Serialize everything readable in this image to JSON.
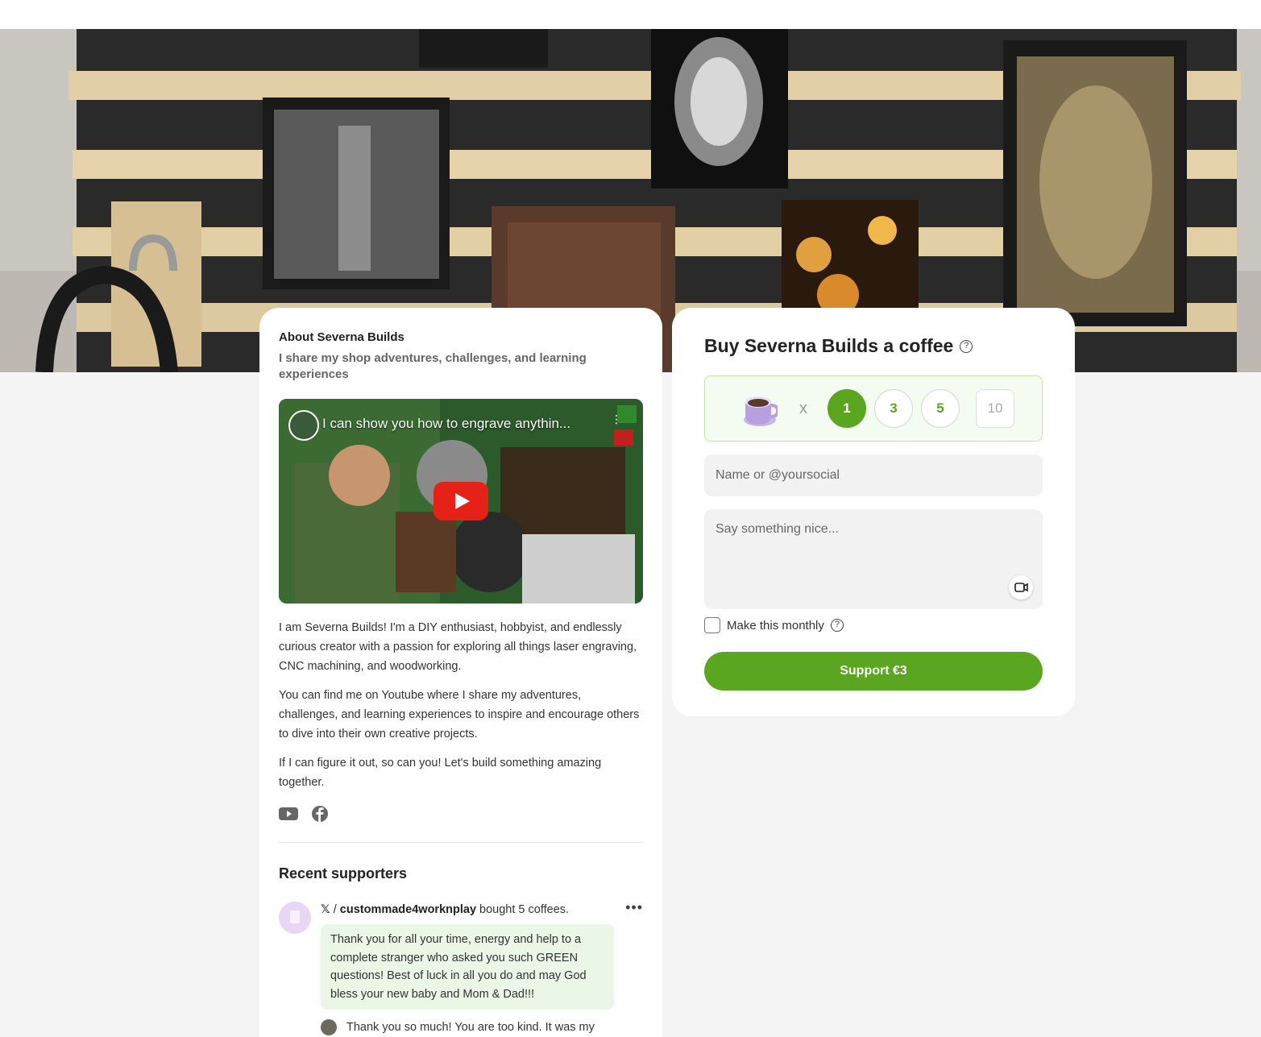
{
  "about": {
    "title": "About Severna Builds",
    "tagline": "I share my shop adventures, challenges, and learning experiences",
    "video": {
      "title": "I can show you how to engrave anythin..."
    },
    "bio": [
      "I am Severna Builds! I'm a DIY enthusiast, hobbyist, and endlessly curious creator with a passion for exploring all things laser engraving, CNC machining, and woodworking.",
      "You can find me on Youtube where I share my adventures, challenges, and learning experiences to inspire and encourage others to dive into their own creative projects.",
      "If I can figure it out, so can you! Let's build something amazing together."
    ],
    "social": [
      "youtube-icon",
      "facebook-icon"
    ]
  },
  "recent": {
    "title": "Recent supporters",
    "items": [
      {
        "platform": "𝕏",
        "handle": "custommade4worknplay",
        "action": "bought 5 coffees.",
        "message": "Thank you for all your time, energy and help to a complete stranger who asked you such GREEN questions! Best of luck in all you do and may God bless your new baby and Mom & Dad!!!",
        "reply": "Thank you so much! You are too kind. It was my"
      }
    ]
  },
  "buy": {
    "title": "Buy Severna Builds a coffee",
    "help": "?",
    "times": "x",
    "options": [
      "1",
      "3",
      "5"
    ],
    "selected": "1",
    "custom_value": "10",
    "name_placeholder": "Name or @yoursocial",
    "message_placeholder": "Say something nice...",
    "monthly_label": "Make this monthly",
    "support_label": "Support €3"
  },
  "colors": {
    "accent": "#5aa621",
    "qty_bg": "#f4fbf0",
    "message_bg": "#eaf6e6"
  }
}
